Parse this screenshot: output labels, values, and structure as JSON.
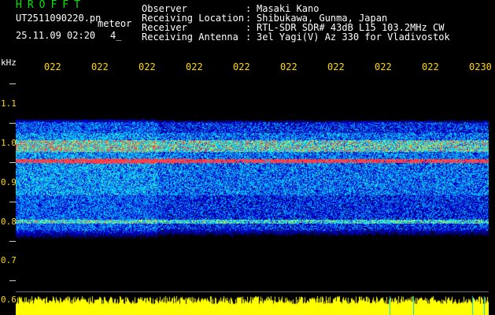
{
  "header": {
    "title": "HROFFT",
    "filename": "UT2511090220.pn",
    "meteor_label": "meteor",
    "datetime": "25.11.09 02:20",
    "count": "4_"
  },
  "info": [
    {
      "label": "Observer",
      "value": "Masaki Kano"
    },
    {
      "label": "Receiving Location",
      "value": "Shibukawa, Gunma, Japan"
    },
    {
      "label": "Receiver",
      "value": "RTL-SDR SDR# 43dB L15 103.2MHz CW"
    },
    {
      "label": "Receiving Antenna",
      "value": "3el Yagi(V) Az 330 for Vladivostok"
    }
  ],
  "colon": ":",
  "y_axis": {
    "unit": "kHz",
    "ticks": [
      "1.1",
      "1.0",
      "0.9",
      "0.8",
      "0.7",
      "0.6"
    ]
  },
  "x_axis": {
    "ticks": [
      "022",
      "022",
      "022",
      "022",
      "022",
      "022",
      "022",
      "022",
      "022",
      "0230"
    ]
  },
  "colors": {
    "title": "#00e600",
    "ticks": "#ffd800",
    "signal": "#ff3040",
    "noise_bar": "#ffff00"
  }
}
